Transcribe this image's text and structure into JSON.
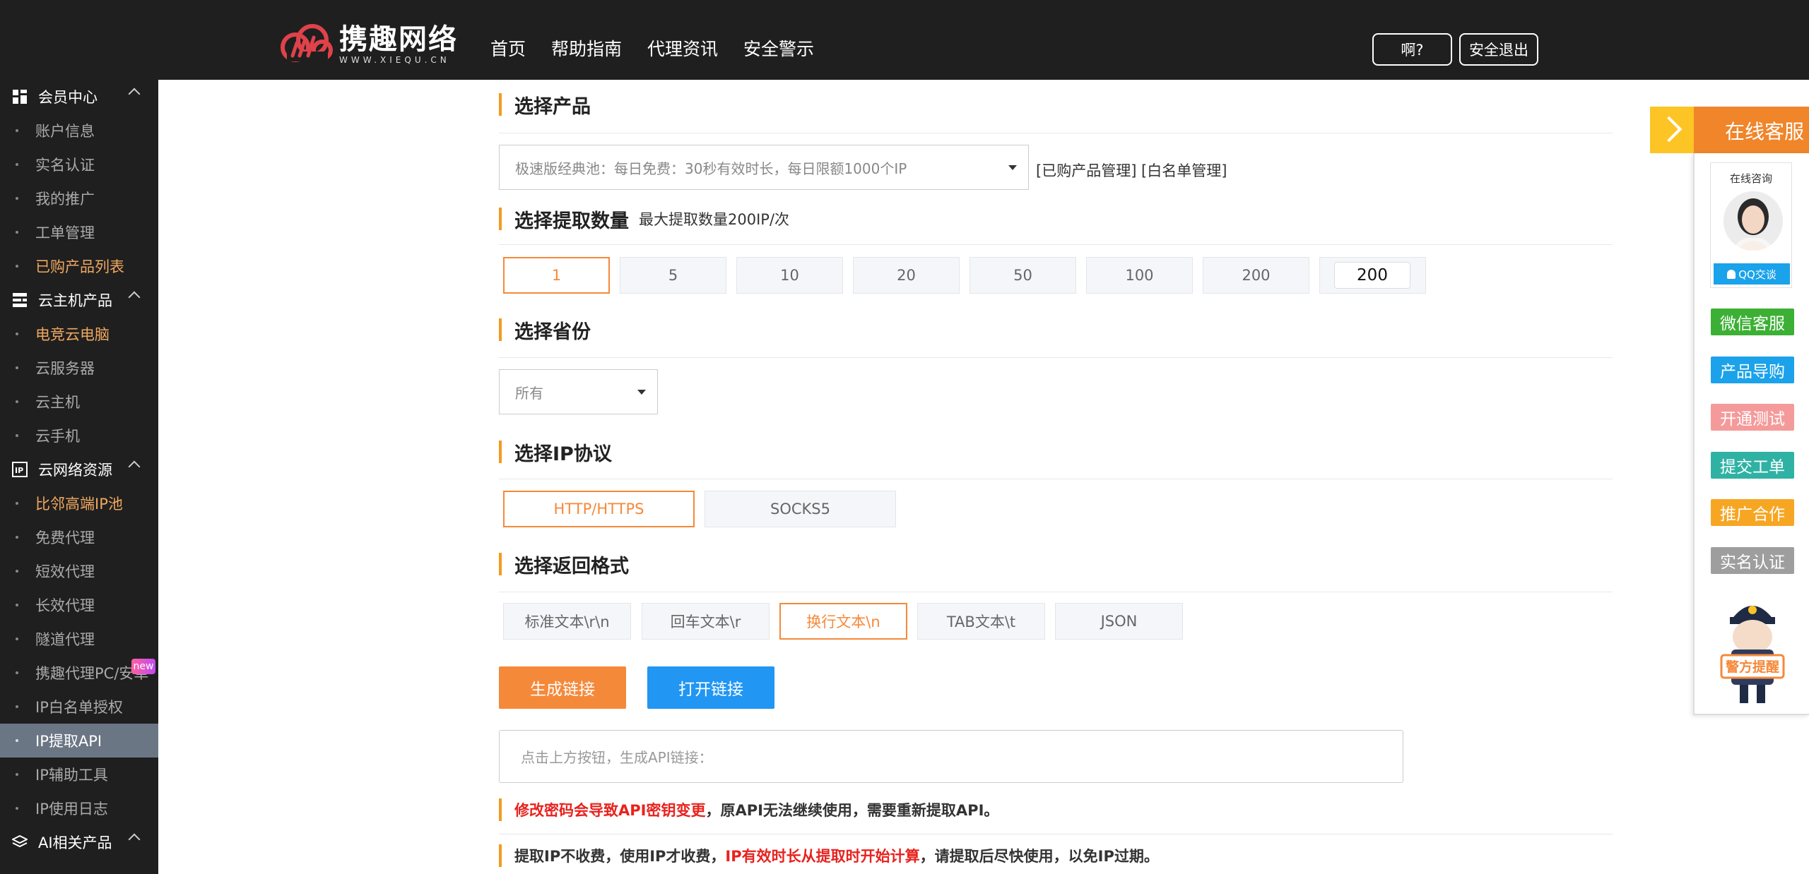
{
  "header": {
    "logo_title": "携趣网络",
    "logo_sub": "WWW.XIEQU.CN",
    "nav": [
      "首页",
      "帮助指南",
      "代理资讯",
      "安全警示"
    ],
    "question_btn": "啊?",
    "logout_btn": "安全退出"
  },
  "sidebar": {
    "groups": [
      {
        "label": "会员中心",
        "icon": "grid-icon",
        "items": [
          {
            "label": "账户信息",
            "state": "normal"
          },
          {
            "label": "实名认证",
            "state": "normal"
          },
          {
            "label": "我的推广",
            "state": "normal"
          },
          {
            "label": "工单管理",
            "state": "normal"
          },
          {
            "label": "已购产品列表",
            "state": "highlight"
          }
        ]
      },
      {
        "label": "云主机产品",
        "icon": "server-icon",
        "items": [
          {
            "label": "电竞云电脑",
            "state": "highlight"
          },
          {
            "label": "云服务器",
            "state": "normal"
          },
          {
            "label": "云主机",
            "state": "normal"
          },
          {
            "label": "云手机",
            "state": "normal"
          }
        ]
      },
      {
        "label": "云网络资源",
        "icon": "ip-icon",
        "items": [
          {
            "label": "比邻高端IP池",
            "state": "highlight"
          },
          {
            "label": "免费代理",
            "state": "normal"
          },
          {
            "label": "短效代理",
            "state": "normal"
          },
          {
            "label": "长效代理",
            "state": "normal"
          },
          {
            "label": "隧道代理",
            "state": "normal"
          },
          {
            "label": "携趣代理PC/安卓",
            "state": "normal",
            "badge": "new"
          },
          {
            "label": "IP白名单授权",
            "state": "normal"
          },
          {
            "label": "IP提取API",
            "state": "active"
          },
          {
            "label": "IP辅助工具",
            "state": "normal"
          },
          {
            "label": "IP使用日志",
            "state": "normal"
          }
        ]
      },
      {
        "label": "AI相关产品",
        "icon": "layers-icon",
        "items": []
      }
    ]
  },
  "main": {
    "product": {
      "title": "选择产品",
      "selected": "极速版经典池：每日免费：30秒有效时长，每日限额1000个IP",
      "links": "[已购产品管理]  [白名单管理]"
    },
    "quantity": {
      "title": "选择提取数量",
      "subtitle": "最大提取数量200IP/次",
      "options": [
        "1",
        "5",
        "10",
        "20",
        "50",
        "100",
        "200"
      ],
      "selected": "1",
      "custom_value": "200"
    },
    "province": {
      "title": "选择省份",
      "selected": "所有"
    },
    "protocol": {
      "title": "选择IP协议",
      "options": [
        "HTTP/HTTPS",
        "SOCKS5"
      ],
      "selected": "HTTP/HTTPS"
    },
    "format": {
      "title": "选择返回格式",
      "options": [
        "标准文本\\r\\n",
        "回车文本\\r",
        "换行文本\\n",
        "TAB文本\\t",
        "JSON"
      ],
      "selected": "换行文本\\n"
    },
    "buttons": {
      "generate": "生成链接",
      "open": "打开链接"
    },
    "result_placeholder": "点击上方按钮，生成API链接：",
    "notes": [
      {
        "red": "修改密码会导致API密钥变更",
        "rest": "，原API无法继续使用，需要重新提取API。"
      },
      {
        "pre": "提取IP不收费，使用IP才收费，",
        "red": "IP有效时长从提取时开始计算",
        "rest": "，请提取后尽快使用，以免IP过期。"
      }
    ]
  },
  "float_panel": {
    "header": "在线客服",
    "consult_label": "在线咨询",
    "qq_btn": "QQ交谈",
    "tags": [
      {
        "label": "微信客服",
        "color": "#3cb034"
      },
      {
        "label": "产品导购",
        "color": "#1ba2ea"
      },
      {
        "label": "开通测试",
        "color": "#f59a9a"
      },
      {
        "label": "提交工单",
        "color": "#2fb2a4"
      },
      {
        "label": "推广合作",
        "color": "#f7a623"
      },
      {
        "label": "实名认证",
        "color": "#9e9e9e"
      }
    ],
    "police_label": "警方提醒"
  },
  "colors": {
    "accent": "#f5893a",
    "blue": "#2196f3",
    "sidebar_bg": "#1f1f1f"
  }
}
